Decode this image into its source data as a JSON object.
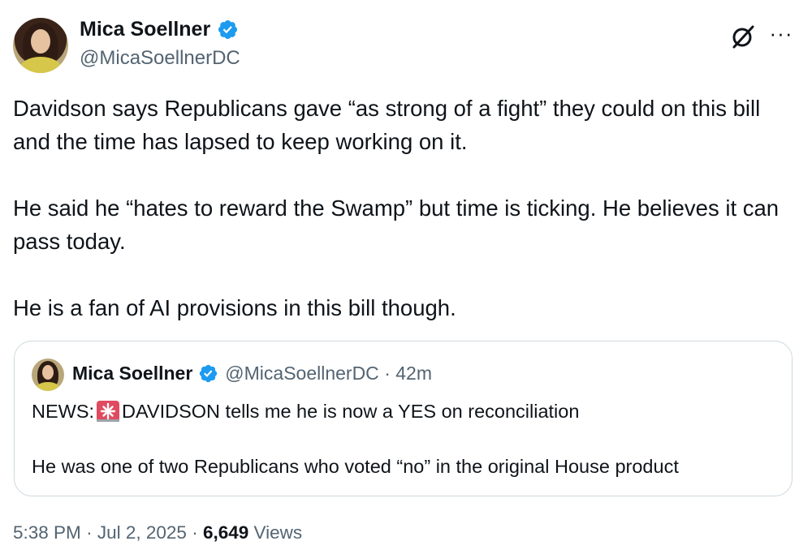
{
  "author": {
    "name": "Mica Soellner",
    "handle": "@MicaSoellnerDC",
    "verified_color": "#1d9bf0"
  },
  "header_icons": {
    "grok": "grok-icon",
    "more": "more-icon",
    "more_glyph": "···"
  },
  "tweet": {
    "paragraphs": [
      "Davidson says Republicans gave “as strong of a fight” they could on this bill and the time has lapsed to keep working on it.",
      "He said he “hates to reward the Swamp” but time is ticking. He believes it can pass today.",
      "He is a fan of AI provisions in this bill though."
    ]
  },
  "quote": {
    "name": "Mica Soellner",
    "handle": "@MicaSoellnerDC",
    "separator": "·",
    "time": "42m",
    "line1_prefix": "NEWS:",
    "line1_emoji": "siren-icon",
    "line1_suffix": "DAVIDSON tells me he is now a YES on reconciliation",
    "line2": "He was one of two Republicans who voted “no” in the original House product"
  },
  "footer": {
    "time": "5:38 PM",
    "sep1": "·",
    "date": "Jul 2, 2025",
    "sep2": "·",
    "views_count": "6,649",
    "views_label": "Views"
  },
  "colors": {
    "text": "#0f1419",
    "secondary": "#536471",
    "border": "#cfd9de",
    "accent": "#1d9bf0"
  }
}
